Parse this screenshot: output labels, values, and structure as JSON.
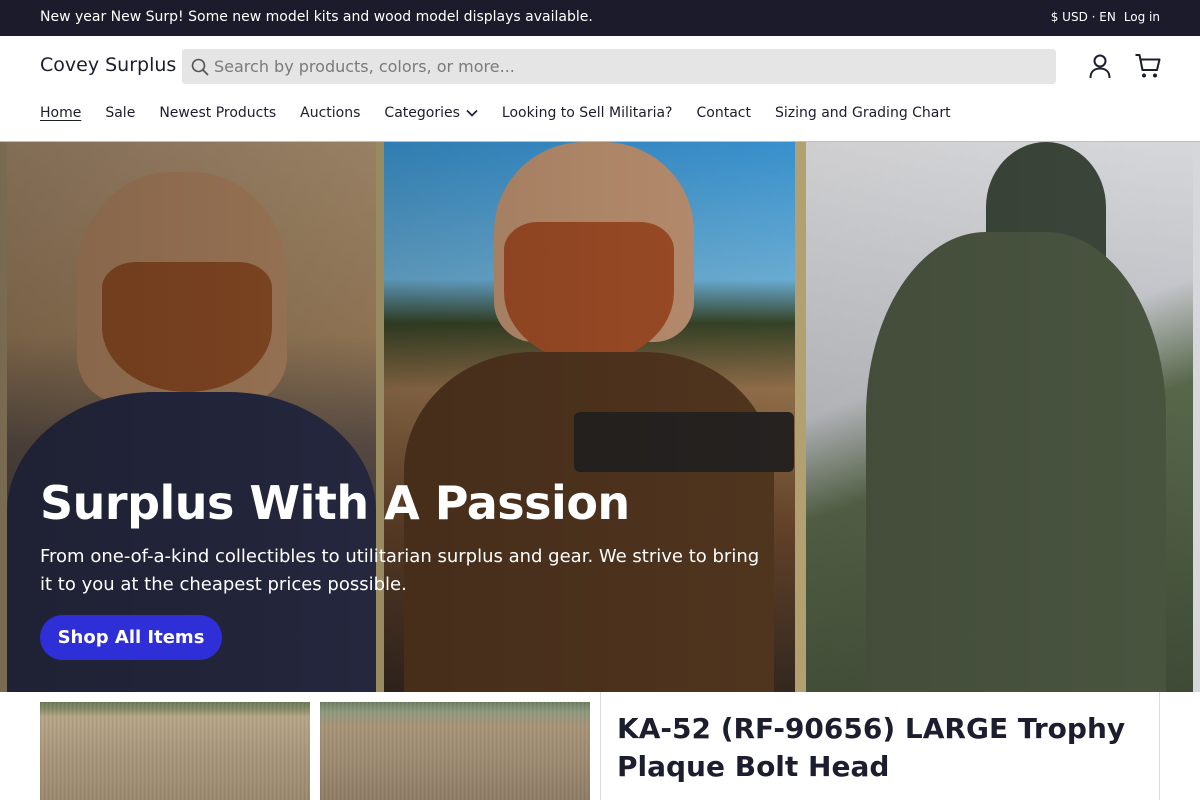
{
  "announcement": {
    "message": "New year New Surp! Some new model kits and wood model displays available.",
    "currency": "$ USD · EN",
    "login": "Log in"
  },
  "header": {
    "logo": "Covey Surplus",
    "search_placeholder": "Search by products, colors, or more...",
    "icons": [
      "search-icon",
      "account-icon",
      "cart-icon"
    ]
  },
  "nav": {
    "items": [
      {
        "label": "Home",
        "active": true
      },
      {
        "label": "Sale"
      },
      {
        "label": "Newest Products"
      },
      {
        "label": "Auctions"
      },
      {
        "label": "Categories",
        "has_dropdown": true
      },
      {
        "label": "Looking to Sell Militaria?"
      },
      {
        "label": "Contact"
      },
      {
        "label": "Sizing and Grading Chart"
      }
    ]
  },
  "hero": {
    "title": "Surplus With A Passion",
    "subtitle": "From one-of-a-kind collectibles to utilitarian surplus and gear. We strive to bring it to you at the cheapest prices possible.",
    "button": "Shop All Items"
  },
  "product": {
    "title": "KA-52 (RF-90656) LARGE Trophy Plaque Bolt Head"
  },
  "colors": {
    "announcement_bg": "#1b1b2b",
    "accent": "#2e2fd6",
    "search_bg": "#e5e5e5"
  }
}
